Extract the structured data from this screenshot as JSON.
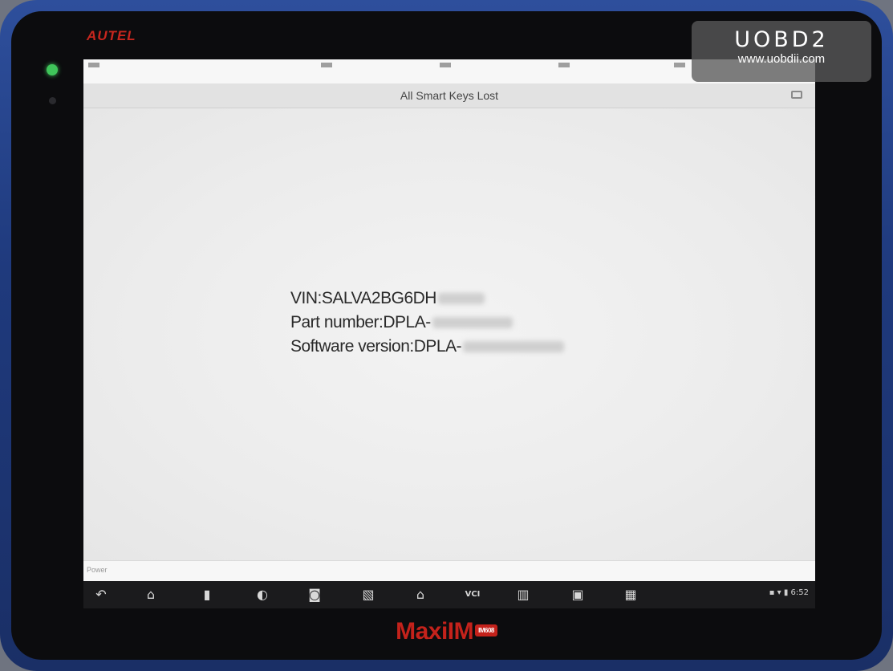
{
  "device": {
    "brand": "AUTEL",
    "model": "MaxiIM",
    "model_badge": "IM608"
  },
  "header": {
    "title": "All Smart Keys Lost"
  },
  "vehicle_info": {
    "vin_label": "VIN:SALVA2BG6DH",
    "part_number_label": "Part number:DPLA-",
    "software_version_label": "Software version:DPLA-"
  },
  "footer": {
    "text": "Power"
  },
  "nav_bar": {
    "buttons": [
      {
        "name": "back",
        "glyph": "↶"
      },
      {
        "name": "home",
        "glyph": "⌂"
      },
      {
        "name": "recent-apps",
        "glyph": "▮"
      },
      {
        "name": "browser",
        "glyph": "◐"
      },
      {
        "name": "camera",
        "glyph": "◙"
      },
      {
        "name": "gallery",
        "glyph": "▧"
      },
      {
        "name": "maxi-home",
        "glyph": "⌂"
      },
      {
        "name": "vci",
        "glyph": "VCI"
      },
      {
        "name": "data-manager",
        "glyph": "▥"
      },
      {
        "name": "vehicle",
        "glyph": "▣"
      },
      {
        "name": "network",
        "glyph": "▦"
      }
    ],
    "time": "6:52"
  },
  "watermark": {
    "brand": "UOBD2",
    "url": "www.uobdii.com"
  },
  "colors": {
    "brand_red": "#c4221b",
    "shell_blue": "#1f3a7d",
    "led_green": "#3fc55a"
  }
}
